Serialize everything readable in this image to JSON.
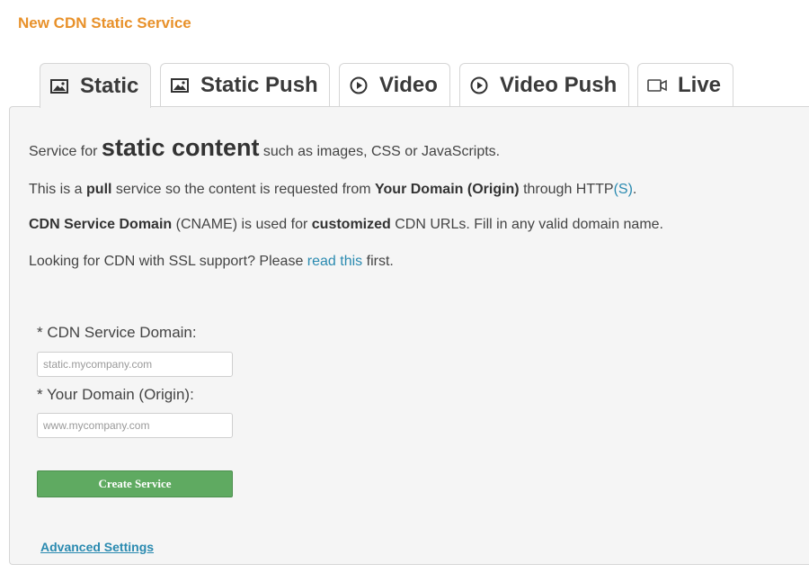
{
  "page": {
    "title": "New CDN Static Service"
  },
  "tabs": [
    {
      "label": "Static",
      "icon": "image-icon",
      "active": true
    },
    {
      "label": "Static Push",
      "icon": "image-icon",
      "active": false
    },
    {
      "label": "Video",
      "icon": "play-circle-icon",
      "active": false
    },
    {
      "label": "Video Push",
      "icon": "play-circle-icon",
      "active": false
    },
    {
      "label": "Live",
      "icon": "video-camera-icon",
      "active": false
    }
  ],
  "intro": {
    "line1": {
      "pre": "Service for ",
      "emphasis": "static content",
      "post": " such as images, CSS or JavaScripts."
    },
    "line2": {
      "pre": "This is a ",
      "b1": "pull",
      "mid": " service so the content is requested from ",
      "b2": "Your Domain (Origin)",
      "post": " through HTTP",
      "link": "(S)",
      "end": "."
    },
    "line3": {
      "b1": "CDN Service Domain",
      "mid": " (CNAME) is used for ",
      "b2": "customized",
      "post": " CDN URLs. Fill in any valid domain name."
    },
    "line4": {
      "pre": "Looking for CDN with SSL support? Please ",
      "link": "read this",
      "post": " first."
    }
  },
  "form": {
    "cdn_domain": {
      "label": "* CDN Service Domain:",
      "placeholder": "static.mycompany.com",
      "value": ""
    },
    "origin_domain": {
      "label": "* Your Domain (Origin):",
      "placeholder": "www.mycompany.com",
      "value": ""
    },
    "submit_label": "Create Service"
  },
  "advanced_settings_label": "Advanced Settings",
  "colors": {
    "title": "#e8912a",
    "link": "#2a8ab0",
    "button": "#5faa61",
    "panel": "#f5f5f5"
  }
}
